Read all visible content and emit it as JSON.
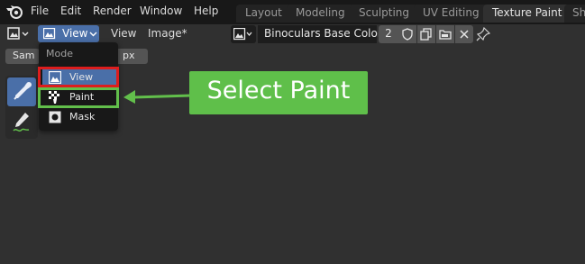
{
  "top_menu": {
    "items": [
      "File",
      "Edit",
      "Render",
      "Window",
      "Help"
    ]
  },
  "workspace_tabs": [
    {
      "label": "Layout",
      "active": false
    },
    {
      "label": "Modeling",
      "active": false
    },
    {
      "label": "Sculpting",
      "active": false
    },
    {
      "label": "UV Editing",
      "active": false
    },
    {
      "label": "Texture Paint",
      "active": true
    },
    {
      "label": "Sh",
      "active": false
    }
  ],
  "header": {
    "mode_label": "View",
    "menus": [
      "View",
      "Image*"
    ],
    "image_name": "Binoculars Base Color",
    "image_users": "2"
  },
  "tool_settings": {
    "sample_label": "Sam",
    "size_unit": "px"
  },
  "mode_dropdown": {
    "title": "Mode",
    "items": [
      {
        "label": "View",
        "icon": "image-view-icon",
        "selected": true
      },
      {
        "label": "Paint",
        "icon": "paint-checker-icon",
        "selected": false
      },
      {
        "label": "Mask",
        "icon": "mask-icon",
        "selected": false
      }
    ]
  },
  "annotation": {
    "text": "Select Paint",
    "color": "#5fbf4a",
    "highlight_current": "#dd1d1d",
    "highlight_target": "#62bf4b"
  },
  "colors": {
    "accent": "#4a6fa8",
    "background": "#303030",
    "topbar": "#181818"
  }
}
